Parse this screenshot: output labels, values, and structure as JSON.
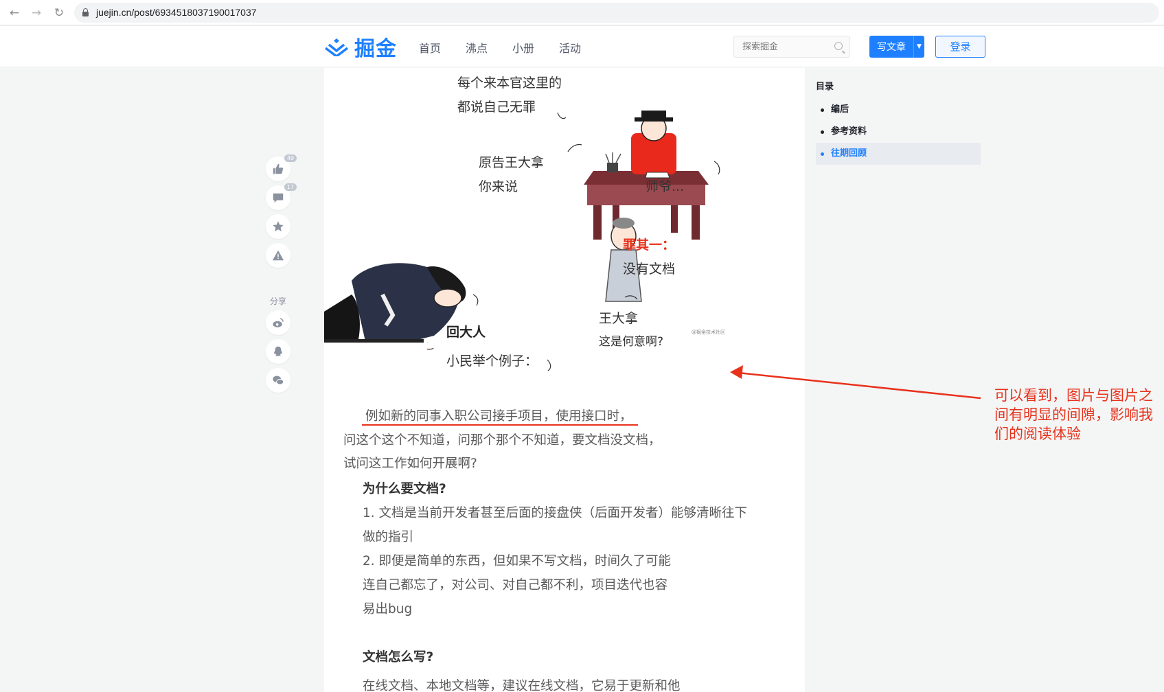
{
  "browser": {
    "url": "juejin.cn/post/6934518037190017037"
  },
  "header": {
    "logo_text": "掘金",
    "nav": [
      "首页",
      "沸点",
      "小册",
      "活动"
    ],
    "search_placeholder": "探索掘金",
    "write_label": "写文章",
    "login_label": "登录"
  },
  "side_actions": {
    "like_count": "49",
    "comment_count": "17",
    "share_label": "分享"
  },
  "comic": {
    "line1": "每个来本官这里的",
    "line2": "都说自己无罪",
    "line3": "原告王大拿",
    "line4": "你来说",
    "line5": "师爷...",
    "charge_title": "罪其一：",
    "charge_text": "没有文档",
    "name": "王大拿",
    "question": "这是何意啊?",
    "reply_title": "回大人",
    "reply_text": "小民举个例子：",
    "watermark": "@掘金技术社区"
  },
  "article": {
    "p1": "例如新的同事入职公司接手项目，使用接口时，",
    "p2": "问这个这个不知道，问那个那个不知道，要文档没文档，",
    "p3": "试问这工作如何开展啊?",
    "h1": "为什么要文档?",
    "l1a": "1. 文档是当前开发者甚至后面的接盘侠（后面开发者）能够清晰往下",
    "l1b": "做的指引",
    "l2a": "2. 即便是简单的东西，但如果不写文档，时间久了可能",
    "l2b": "连自己都忘了，对公司、对自己都不利，项目迭代也容",
    "l2c": "易出bug",
    "h2": "文档怎么写?",
    "p4": "在线文档、本地文档等，建议在线文档，它易于更新和他"
  },
  "toc": {
    "title": "目录",
    "items": [
      {
        "label": "编后",
        "active": false
      },
      {
        "label": "参考资料",
        "active": false
      },
      {
        "label": "往期回顾",
        "active": true
      }
    ]
  },
  "annotation": {
    "text": "可以看到，图片与图片之间有明显的间隙，影响我们的阅读体验",
    "color": "#e8311b"
  },
  "colors": {
    "brand": "#1e80ff",
    "annotation_red": "#e8311b"
  }
}
